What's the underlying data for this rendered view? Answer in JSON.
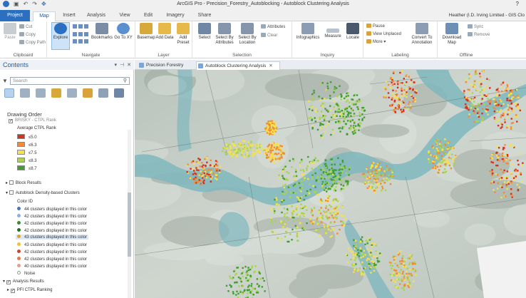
{
  "app": {
    "title": "ArcGIS Pro - Precision_Forestry_Autoblocking - Autoblock Clustering Analysis",
    "help": "?",
    "user": "Heather (I.D. Irving Limited - GIS Clo",
    "qat_icons": [
      "app-icon",
      "save-icon",
      "undo-icon",
      "redo-icon",
      "pointer-icon"
    ]
  },
  "ribbon": {
    "tabs": [
      "Project",
      "Map",
      "Insert",
      "Analysis",
      "View",
      "Edit",
      "Imagery",
      "Share"
    ],
    "active_tab": "Map",
    "groups": {
      "clipboard": {
        "label": "Clipboard",
        "paste": "Paste",
        "cut": "Cut",
        "copy": "Copy",
        "copy_path": "Copy Path"
      },
      "navigate": {
        "label": "Navigate",
        "explore": "Explore",
        "bookmarks": "Bookmarks",
        "go_to_xy": "Go To XY"
      },
      "layer": {
        "label": "Layer",
        "basemap": "Basemap",
        "add_data": "Add Data",
        "add_preset": "Add Preset"
      },
      "selection": {
        "label": "Selection",
        "select": "Select",
        "select_by_attributes": "Select By Attributes",
        "select_by_location": "Select By Location",
        "attributes": "Attributes",
        "clear": "Clear"
      },
      "inquiry": {
        "label": "Inquiry",
        "infographics": "Infographics",
        "measure": "Measure",
        "locate": "Locate"
      },
      "labeling": {
        "label": "Labeling",
        "pause": "Pause",
        "view_unplaced": "View Unplaced",
        "more": "More",
        "convert": "Convert To Annotation"
      },
      "offline": {
        "label": "Offline",
        "download_map": "Download Map",
        "sync": "Sync",
        "remove": "Remove"
      }
    }
  },
  "contents": {
    "title": "Contents",
    "search_placeholder": "Search",
    "section": "Drawing Order",
    "layer_top": "BRISKY - CTPL Rank",
    "legend_title": "Average CTPL Rank",
    "ranks": [
      {
        "label": "≤5.0",
        "color": "#d7301f"
      },
      {
        "label": "≤6.3",
        "color": "#f08c33"
      },
      {
        "label": "≤7.5",
        "color": "#f6e24a"
      },
      {
        "label": "≤8.3",
        "color": "#a8d44e"
      },
      {
        "label": "≤8.7",
        "color": "#3f9f33"
      }
    ],
    "block_results": "Block Results",
    "clusters_layer": "Autoblock Density-based Clusters",
    "color_id": "Color ID",
    "clusters": [
      {
        "label": "44 clusters displayed in this color",
        "color": "#4a74b8"
      },
      {
        "label": "42 clusters displayed in this color",
        "color": "#8cb0d9"
      },
      {
        "label": "42 clusters displayed in this color",
        "color": "#3b8a3b"
      },
      {
        "label": "42 clusters displayed in this color",
        "color": "#2d6a2d"
      },
      {
        "label": "43 clusters displayed in this color",
        "color": "#d9a23a"
      },
      {
        "label": "43 clusters displayed in this color",
        "color": "#f0c040"
      },
      {
        "label": "42 clusters displayed in this color",
        "color": "#c04a3a"
      },
      {
        "label": "42 clusters displayed in this color",
        "color": "#e07a50"
      },
      {
        "label": "40 clusters displayed in this color",
        "color": "#e0a090"
      }
    ],
    "noise": "Noise",
    "analysis_results": "Analysis Results",
    "ctpl_ranking": "PFI CTPL Ranking"
  },
  "map_tabs": [
    {
      "label": "Precision Forestry",
      "active": false
    },
    {
      "label": "Autoblock Clustering Analysis",
      "active": true
    }
  ],
  "colors": {
    "accent": "#2a6fc0",
    "water": "#7fb7bd",
    "terrain": "#c8d2c8"
  }
}
